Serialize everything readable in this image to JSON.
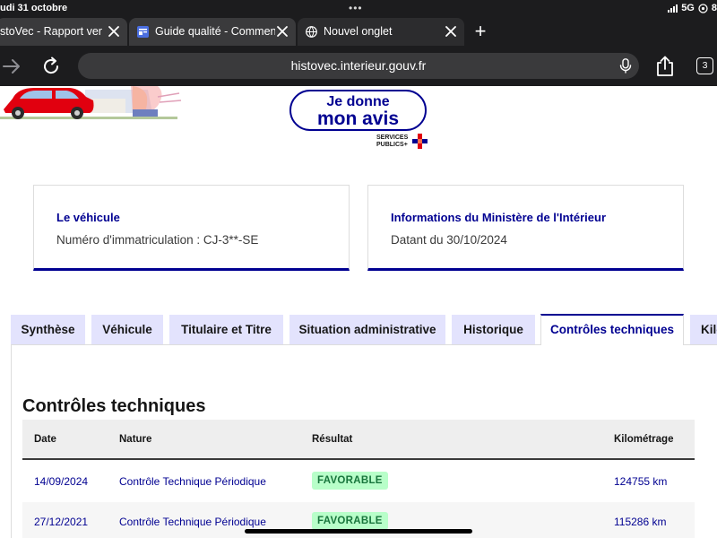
{
  "status_bar": {
    "date": "udi 31 octobre",
    "dots": "•••",
    "network": "5G",
    "battery": "8"
  },
  "browser": {
    "tabs": [
      {
        "label": "stoVec - Rapport vende",
        "active": true
      },
      {
        "label": "Guide qualité - Comment",
        "active": false
      },
      {
        "label": "Nouvel onglet",
        "active": false
      }
    ],
    "new_tab": "+",
    "url": "histovec.interieur.gouv.fr",
    "tab_count": "3"
  },
  "page": {
    "avis_button": {
      "line1": "Je donne",
      "line2": "mon avis"
    },
    "services_publics": {
      "line1": "SERVICES",
      "line2": "PUBLICS+"
    },
    "cards": [
      {
        "title": "Le véhicule",
        "desc": "Numéro d'immatriculation : CJ-3**-SE"
      },
      {
        "title": "Informations du Ministère de l'Intérieur",
        "desc": "Datant du 30/10/2024"
      }
    ],
    "tabs": [
      {
        "label": "Synthèse",
        "active": false
      },
      {
        "label": "Véhicule",
        "active": false
      },
      {
        "label": "Titulaire et Titre",
        "active": false
      },
      {
        "label": "Situation administrative",
        "active": false
      },
      {
        "label": "Historique",
        "active": false
      },
      {
        "label": "Contrôles techniques",
        "active": true
      },
      {
        "label": "Kilo",
        "active": false
      }
    ],
    "section_title": "Contrôles techniques",
    "table": {
      "headers": [
        "Date",
        "Nature",
        "Résultat",
        "Kilométrage"
      ],
      "rows": [
        {
          "date": "14/09/2024",
          "nature": "Contrôle Technique Périodique",
          "result": "FAVORABLE",
          "km": "124755 km"
        },
        {
          "date": "27/12/2021",
          "nature": "Contrôle Technique Périodique",
          "result": "FAVORABLE",
          "km": "115286 km"
        }
      ]
    }
  },
  "colors": {
    "primary": "#000091",
    "tab_bg": "#e3e3fd",
    "badge_bg": "#b8fec9",
    "badge_text": "#18753c",
    "browser_chrome": "#1c1c1e"
  }
}
